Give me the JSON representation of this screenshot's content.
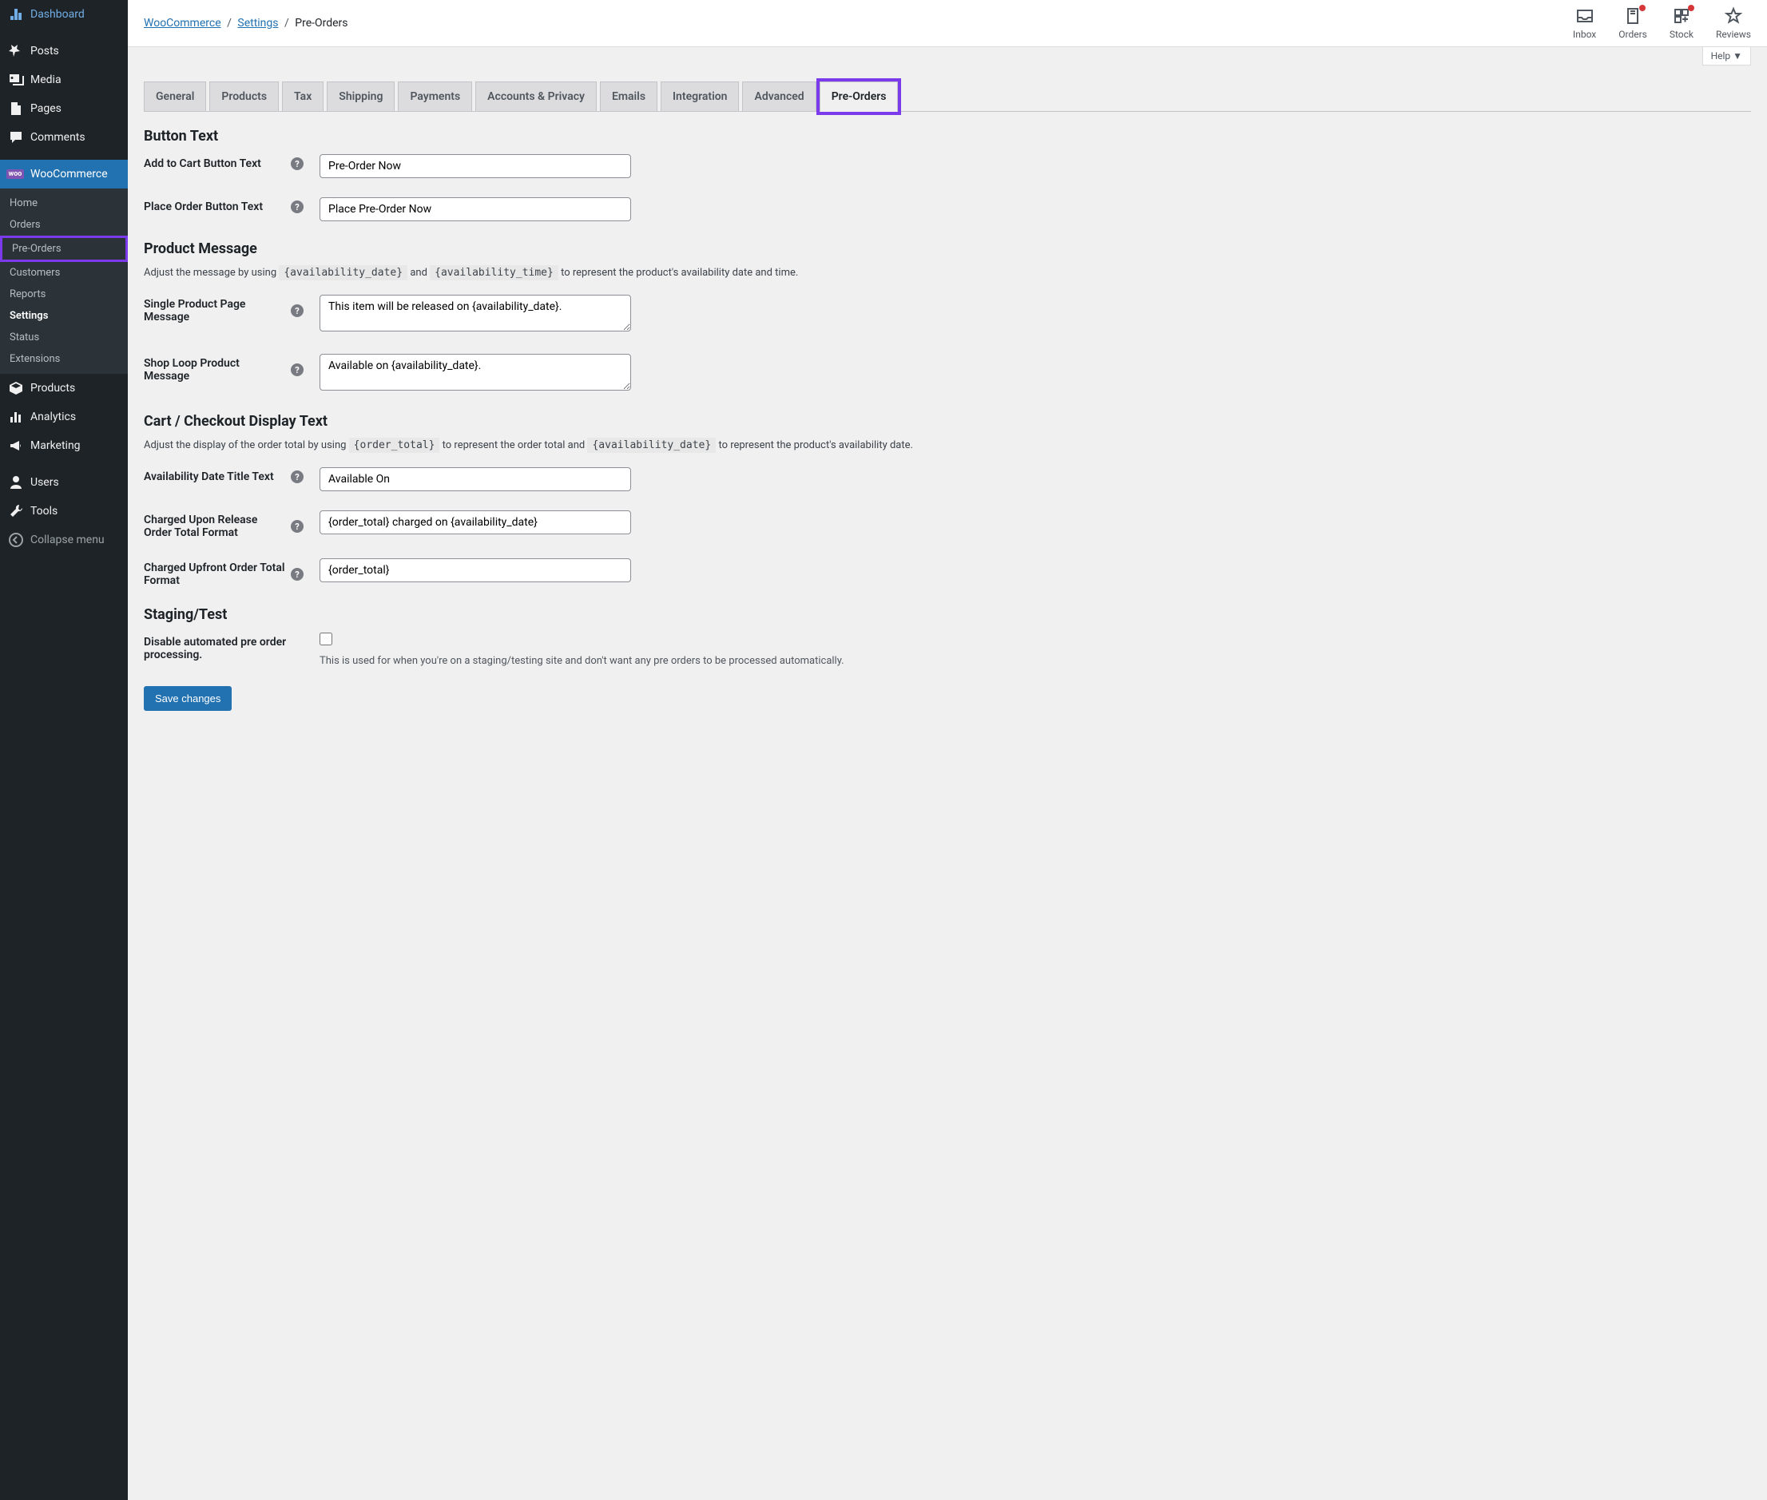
{
  "sidebar": {
    "items": [
      {
        "icon": "dashboard",
        "label": "Dashboard"
      },
      {
        "icon": "pin",
        "label": "Posts"
      },
      {
        "icon": "media",
        "label": "Media"
      },
      {
        "icon": "page",
        "label": "Pages"
      },
      {
        "icon": "comment",
        "label": "Comments"
      },
      {
        "icon": "woo",
        "label": "WooCommerce",
        "active": true
      },
      {
        "icon": "box",
        "label": "Products"
      },
      {
        "icon": "chart",
        "label": "Analytics"
      },
      {
        "icon": "megaphone",
        "label": "Marketing"
      },
      {
        "icon": "user",
        "label": "Users"
      },
      {
        "icon": "wrench",
        "label": "Tools"
      },
      {
        "icon": "collapse",
        "label": "Collapse menu"
      }
    ],
    "sub": [
      "Home",
      "Orders",
      "Pre-Orders",
      "Customers",
      "Reports",
      "Settings",
      "Status",
      "Extensions"
    ]
  },
  "breadcrumb": {
    "woo": "WooCommerce",
    "settings": "Settings",
    "current": "Pre-Orders"
  },
  "top_actions": {
    "inbox": "Inbox",
    "orders": "Orders",
    "stock": "Stock",
    "reviews": "Reviews"
  },
  "help_tab": "Help ▼",
  "tabs": [
    "General",
    "Products",
    "Tax",
    "Shipping",
    "Payments",
    "Accounts & Privacy",
    "Emails",
    "Integration",
    "Advanced",
    "Pre-Orders"
  ],
  "sections": {
    "button_text": {
      "title": "Button Text",
      "fields": {
        "add_to_cart": {
          "label": "Add to Cart Button Text",
          "value": "Pre-Order Now"
        },
        "place_order": {
          "label": "Place Order Button Text",
          "value": "Place Pre-Order Now"
        }
      }
    },
    "product_message": {
      "title": "Product Message",
      "desc_pre": "Adjust the message by using ",
      "code1": "{availability_date}",
      "desc_mid": " and ",
      "code2": "{availability_time}",
      "desc_post": " to represent the product's availability date and time.",
      "fields": {
        "single_product": {
          "label": "Single Product Page Message",
          "value": "This item will be released on {availability_date}."
        },
        "shop_loop": {
          "label": "Shop Loop Product Message",
          "value": "Available on {availability_date}."
        }
      }
    },
    "cart_checkout": {
      "title": "Cart / Checkout Display Text",
      "desc_pre": "Adjust the display of the order total by using ",
      "code1": "{order_total}",
      "desc_mid": " to represent the order total and ",
      "code2": "{availability_date}",
      "desc_post": " to represent the product's availability date.",
      "fields": {
        "avail_title": {
          "label": "Availability Date Title Text",
          "value": "Available On"
        },
        "charged_release": {
          "label": "Charged Upon Release Order Total Format",
          "value": "{order_total} charged on {availability_date}"
        },
        "charged_upfront": {
          "label": "Charged Upfront Order Total Format",
          "value": "{order_total}"
        }
      }
    },
    "staging": {
      "title": "Staging/Test",
      "fields": {
        "disable": {
          "label": "Disable automated pre order processing.",
          "desc": "This is used for when you're on a staging/testing site and don't want any pre orders to be processed automatically."
        }
      }
    }
  },
  "submit": "Save changes"
}
